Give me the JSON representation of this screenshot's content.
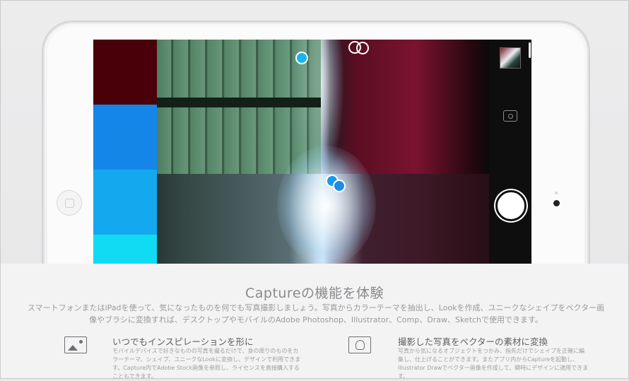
{
  "swatch_colors": [
    "#4a0008",
    "#1386e8",
    "#14a9ef",
    "#10dbf2"
  ],
  "info": {
    "title": "Captureの機能を体験",
    "description": "スマートフォンまたはiPadを使って、気になったものを何でも写真撮影しましょう。写真からカラーテーマを抽出し、Lookを作成、ユニークなシェイプをベクター画像やブラシに変換すれば、デスクトップやモバイルのAdobe Photoshop、Illustrator、Comp、Draw、Sketchで使用できます。"
  },
  "features": [
    {
      "icon": "image-icon",
      "title": "いつでもインスピレーションを形に",
      "body": "モバイルデバイスで好きなものの写真を撮るだけで、身の周りのものをカラーテーマ、シェイプ、ユニークなLookに変換し、デザインで利用できます。Capture内でAdobe Stock画像を参照し、ライセンスを直接購入することもできます。"
    },
    {
      "icon": "vector-shape-icon",
      "title": "撮影した写真をベクターの素材に変換",
      "body": "写真から気になるオブジェクトをつかみ、指先だけでシェイプを正確に編集し、仕上げることができます。またアプリ内からCaptureを起動し、Illustrator Drawでベクター画像を作成して、瞬時にデザインに適用できます。"
    }
  ]
}
